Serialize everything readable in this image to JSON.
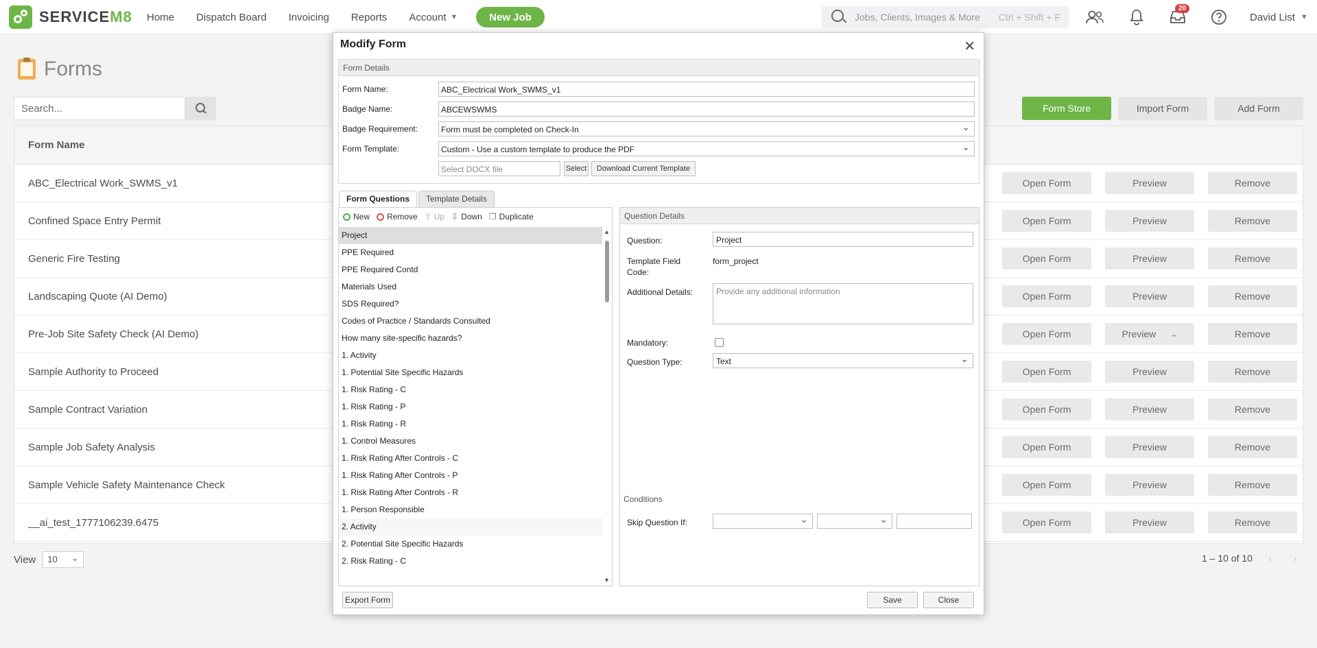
{
  "app": {
    "brand_service": "SERVICE",
    "brand_m8": "M8",
    "nav": [
      "Home",
      "Dispatch Board",
      "Invoicing",
      "Reports",
      "Account"
    ],
    "new_job": "New Job",
    "search_placeholder": "Jobs, Clients, Images & More",
    "search_shortcut": "Ctrl + Shift + F",
    "inbox_badge": "20",
    "user": "David List"
  },
  "page": {
    "title": "Forms",
    "search_placeholder": "Search...",
    "buttons": {
      "store": "Form Store",
      "import": "Import Form",
      "add": "Add Form"
    },
    "column": "Form Name",
    "rows": [
      "ABC_Electrical Work_SWMS_v1",
      "Confined Space Entry Permit",
      "Generic Fire Testing",
      "Landscaping Quote (AI Demo)",
      "Pre-Job Site Safety Check (AI Demo)",
      "Sample Authority to Proceed",
      "Sample Contract Variation",
      "Sample Job Safety Analysis",
      "Sample Vehicle Safety Maintenance Check",
      "__ai_test_1777106239.6475"
    ],
    "actions": {
      "open": "Open Form",
      "preview": "Preview",
      "remove": "Remove"
    },
    "view_label": "View",
    "view_value": "10",
    "pager": "1 – 10 of 10"
  },
  "modal": {
    "title": "Modify Form",
    "details_head": "Form Details",
    "labels": {
      "name": "Form Name:",
      "badge": "Badge Name:",
      "requirement": "Badge Requirement:",
      "template": "Form Template:"
    },
    "values": {
      "name": "ABC_Electrical Work_SWMS_v1",
      "badge": "ABCEWSWMS",
      "requirement": "Form must be completed on Check-In",
      "template": "Custom - Use a custom template to produce the PDF"
    },
    "docx_placeholder": "Select DOCX file",
    "select_btn": "Select",
    "download_btn": "Download Current Template",
    "tabs": [
      "Form Questions",
      "Template Details"
    ],
    "toolbar": {
      "new": "New",
      "remove": "Remove",
      "up": "Up",
      "down": "Down",
      "duplicate": "Duplicate"
    },
    "questions": [
      "Project",
      "PPE Required",
      "PPE Required Contd",
      "Materials Used",
      "SDS Required?",
      "Codes of Practice / Standards Consulted",
      "How many site-specific hazards?",
      "1. Activity",
      "1. Potential Site Specific Hazards",
      "1. Risk Rating - C",
      "1. Risk Rating - P",
      "1. Risk Rating - R",
      "1. Control Measures",
      "1. Risk Rating After Controls - C",
      "1. Risk Rating After Controls - P",
      "1. Risk Rating After Controls - R",
      "1. Person Responsible",
      "2. Activity",
      "2. Potential Site Specific Hazards",
      "2. Risk Rating - C"
    ],
    "qdetail": {
      "head": "Question Details",
      "question_label": "Question:",
      "question_value": "Project",
      "code_label_1": "Template Field",
      "code_label_2": "Code:",
      "code_value": "form_project",
      "additional_label": "Additional Details:",
      "additional_placeholder": "Provide any additional information",
      "mandatory_label": "Mandatory:",
      "type_label": "Question Type:",
      "type_value": "Text",
      "conditions": "Conditions",
      "skip_label": "Skip Question If:"
    },
    "footer": {
      "export": "Export Form",
      "save": "Save",
      "close": "Close"
    }
  }
}
